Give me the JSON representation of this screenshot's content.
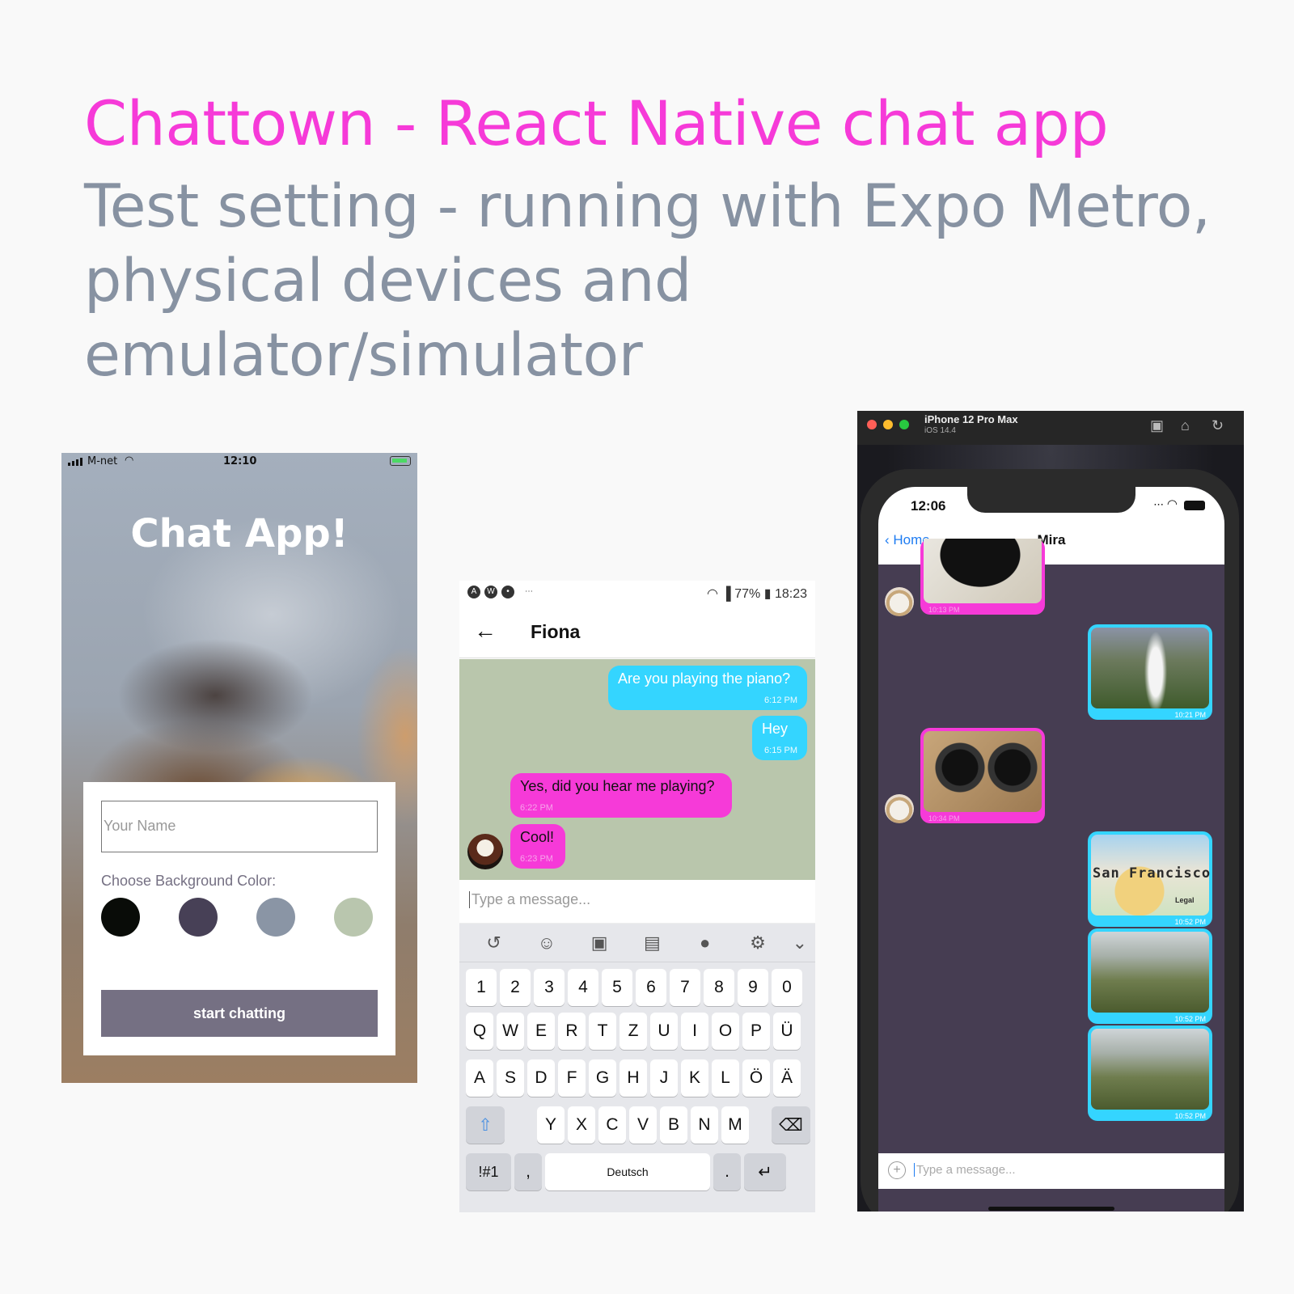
{
  "page": {
    "title": "Chattown - React Native chat app",
    "subtitle": "Test setting - running with Expo Metro, physical devices and emulator/simulator"
  },
  "phone_ios_start": {
    "status": {
      "carrier": "M-net",
      "time": "12:10"
    },
    "app_title": "Chat App!",
    "name_placeholder": "Your Name",
    "choose_label": "Choose Background Color:",
    "colors": [
      "#090C08",
      "#474056",
      "#8A95A5",
      "#B9C6AE"
    ],
    "button_label": "start chatting"
  },
  "phone_android_chat": {
    "status": {
      "battery": "77%",
      "time": "18:23"
    },
    "contact_name": "Fiona",
    "messages": [
      {
        "text": "Are you playing the piano?",
        "time": "6:12 PM",
        "side": "right"
      },
      {
        "text": "Hey",
        "time": "6:15 PM",
        "side": "right"
      },
      {
        "text": "Yes, did you hear me playing?",
        "time": "6:22 PM",
        "side": "left"
      },
      {
        "text": "Cool!",
        "time": "6:23 PM",
        "side": "left"
      }
    ],
    "composer_placeholder": "Type a message...",
    "keyboard": {
      "row_numbers": [
        "1",
        "2",
        "3",
        "4",
        "5",
        "6",
        "7",
        "8",
        "9",
        "0"
      ],
      "row_1": [
        "Q",
        "W",
        "E",
        "R",
        "T",
        "Z",
        "U",
        "I",
        "O",
        "P",
        "Ü"
      ],
      "row_2": [
        "A",
        "S",
        "D",
        "F",
        "G",
        "H",
        "J",
        "K",
        "L",
        "Ö",
        "Ä"
      ],
      "row_3": [
        "Y",
        "X",
        "C",
        "V",
        "B",
        "N",
        "M"
      ],
      "sym_key": "!#1",
      "comma_key": ",",
      "space_label": "Deutsch",
      "period_key": "."
    }
  },
  "simulator": {
    "device_name": "iPhone 12 Pro Max",
    "os_version": "iOS 14.4",
    "status_time": "12:06",
    "back_label": "Home",
    "contact_name": "Mira",
    "images": [
      {
        "time": "10:13 PM",
        "side": "left"
      },
      {
        "time": "10:21 PM",
        "side": "right"
      },
      {
        "time": "10:34 PM",
        "side": "left"
      },
      {
        "time": "10:52 PM",
        "side": "right",
        "map_label": "San Francisco",
        "legal": "Legal"
      },
      {
        "time": "10:52 PM",
        "side": "right"
      },
      {
        "time": "10:52 PM",
        "side": "right"
      }
    ],
    "composer_placeholder": "Type a message..."
  }
}
